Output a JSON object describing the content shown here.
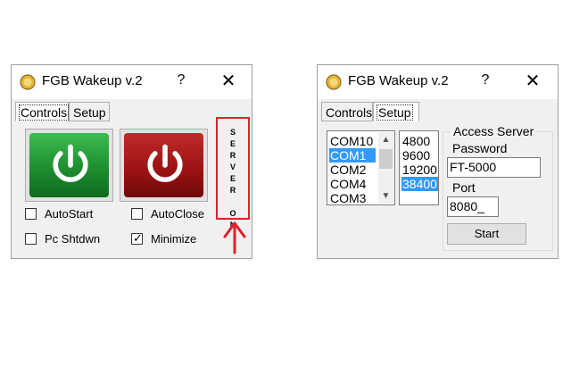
{
  "left_window": {
    "title": "FGB Wakeup v.2",
    "help_label": "?",
    "close_label": "✕",
    "tabs": [
      {
        "label": "Controls",
        "active": true
      },
      {
        "label": "Setup",
        "active": false
      }
    ],
    "power_on_button": {
      "icon": "power-icon",
      "color": "#1b8a2e"
    },
    "power_off_button": {
      "icon": "power-icon",
      "color": "#9a1212"
    },
    "checkboxes": [
      {
        "label": "AutoStart",
        "checked": false
      },
      {
        "label": "AutoClose",
        "checked": false
      },
      {
        "label": "Pc Shtdwn",
        "checked": false
      },
      {
        "label": "Minimize",
        "checked": true
      }
    ],
    "checkmark": "✓",
    "server_status": "SERVER ON"
  },
  "right_window": {
    "title": "FGB Wakeup v.2",
    "help_label": "?",
    "close_label": "✕",
    "tabs": [
      {
        "label": "Controls",
        "active": false
      },
      {
        "label": "Setup",
        "active": true
      }
    ],
    "com_ports": [
      {
        "label": "COM10",
        "selected": false
      },
      {
        "label": "COM1",
        "selected": true
      },
      {
        "label": "COM2",
        "selected": false
      },
      {
        "label": "COM4",
        "selected": false
      },
      {
        "label": "COM3",
        "selected": false
      }
    ],
    "baud_rates": [
      {
        "label": "4800",
        "selected": false
      },
      {
        "label": "9600",
        "selected": false
      },
      {
        "label": "19200",
        "selected": false
      },
      {
        "label": "38400",
        "selected": true
      }
    ],
    "access_server": {
      "legend": "Access Server",
      "password_label": "Password",
      "password_value": "FT-5000",
      "port_label": "Port",
      "port_value": "8080_",
      "start_label": "Start"
    }
  },
  "colors": {
    "selection": "#3399ff",
    "highlight_border": "#e0202a"
  }
}
